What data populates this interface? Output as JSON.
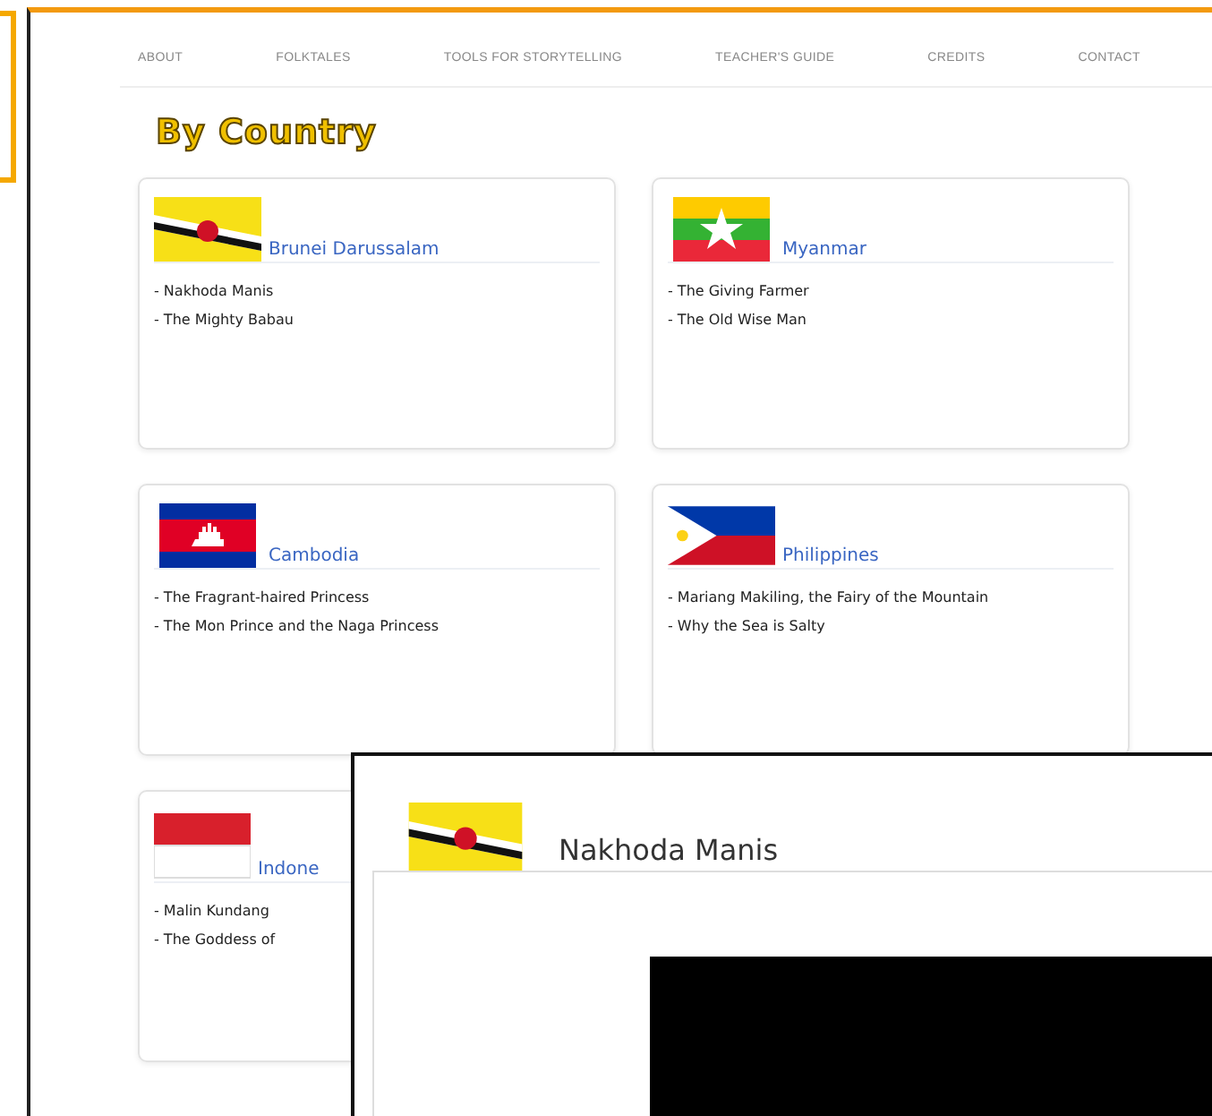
{
  "nav": [
    "ABOUT",
    "FOLKTALES",
    "TOOLS FOR STORYTELLING",
    "TEACHER'S GUIDE",
    "CREDITS",
    "CONTACT"
  ],
  "heading": "By Country",
  "countries": [
    {
      "name": "Brunei Darussalam",
      "stories": [
        "- Nakhoda Manis",
        "- The Mighty Babau"
      ]
    },
    {
      "name": "Myanmar",
      "stories": [
        "- The Giving Farmer",
        "- The Old Wise Man"
      ]
    },
    {
      "name": "Cambodia",
      "stories": [
        "- The Fragrant-haired Princess",
        "- The Mon Prince and the Naga Princess"
      ]
    },
    {
      "name": "Philippines",
      "stories": [
        "- Mariang Makiling, the Fairy of the Mountain",
        "- Why the Sea is Salty"
      ]
    },
    {
      "name": "Indone",
      "stories": [
        "- Malin Kundang",
        "- The Goddess of"
      ]
    }
  ],
  "popup": {
    "title": "Nakhoda Manis"
  }
}
